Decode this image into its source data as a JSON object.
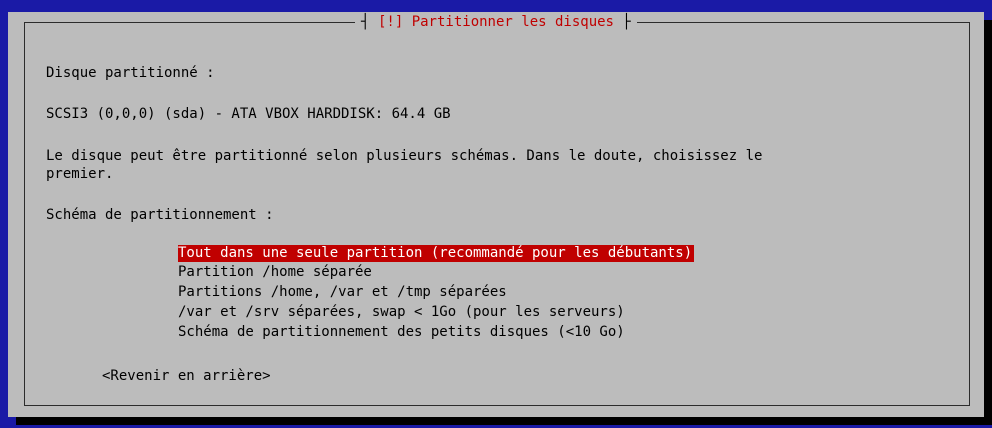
{
  "dialog": {
    "title": "[!] Partitionner les disques",
    "disk_label": "Disque partitionné :",
    "disk_name": "SCSI3 (0,0,0) (sda) - ATA VBOX HARDDISK: 64.4 GB",
    "description_line1": "Le disque peut être partitionné selon plusieurs schémas. Dans le doute, choisissez le",
    "description_line2": "premier.",
    "scheme_label": "Schéma de partitionnement :",
    "options": [
      "Tout dans une seule partition (recommandé pour les débutants)",
      "Partition /home séparée",
      "Partitions /home, /var et /tmp séparées",
      "/var et /srv séparées, swap < 1Go (pour les serveurs)",
      "Schéma de partitionnement des petits disques (<10 Go)"
    ],
    "selected_option": "Tout dans une seule partition (recommandé pour les débutants)",
    "back_button": "<Revenir en arrière>"
  },
  "colors": {
    "screen_background": "#1a1aa6",
    "dialog_background": "#bcbcbc",
    "title_text": "#c00000",
    "selection_background": "#c00000",
    "selection_text": "#ffffff"
  }
}
